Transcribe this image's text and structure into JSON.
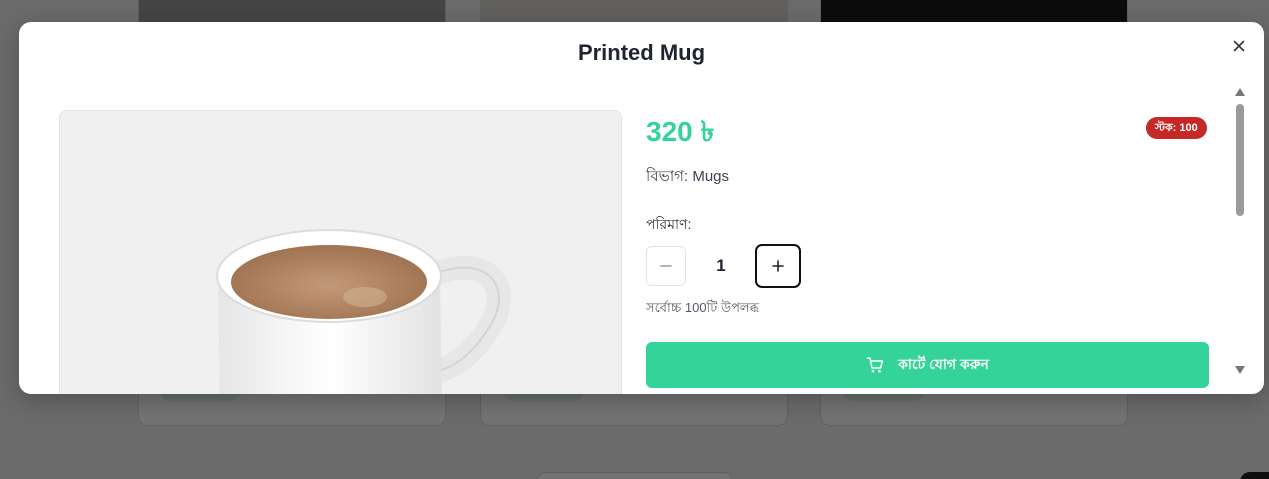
{
  "modal": {
    "title": "Printed Mug",
    "close_icon": "close-icon"
  },
  "product": {
    "image_icon": "coffee-cup-photo",
    "price": "320 ৳",
    "stock_badge": "স্টক: 100",
    "category_label": "বিভাগ:",
    "category_value": "Mugs",
    "quantity_label": "পরিমাণ:",
    "quantity_value": "1",
    "availability": "সর্বোচ্চ 100টি উপলব্ধ",
    "add_to_cart_label": "কার্টে যোগ করুন",
    "add_to_cart_icon": "cart-icon"
  },
  "colors": {
    "accent": "#34d399",
    "badge": "#c62828"
  }
}
